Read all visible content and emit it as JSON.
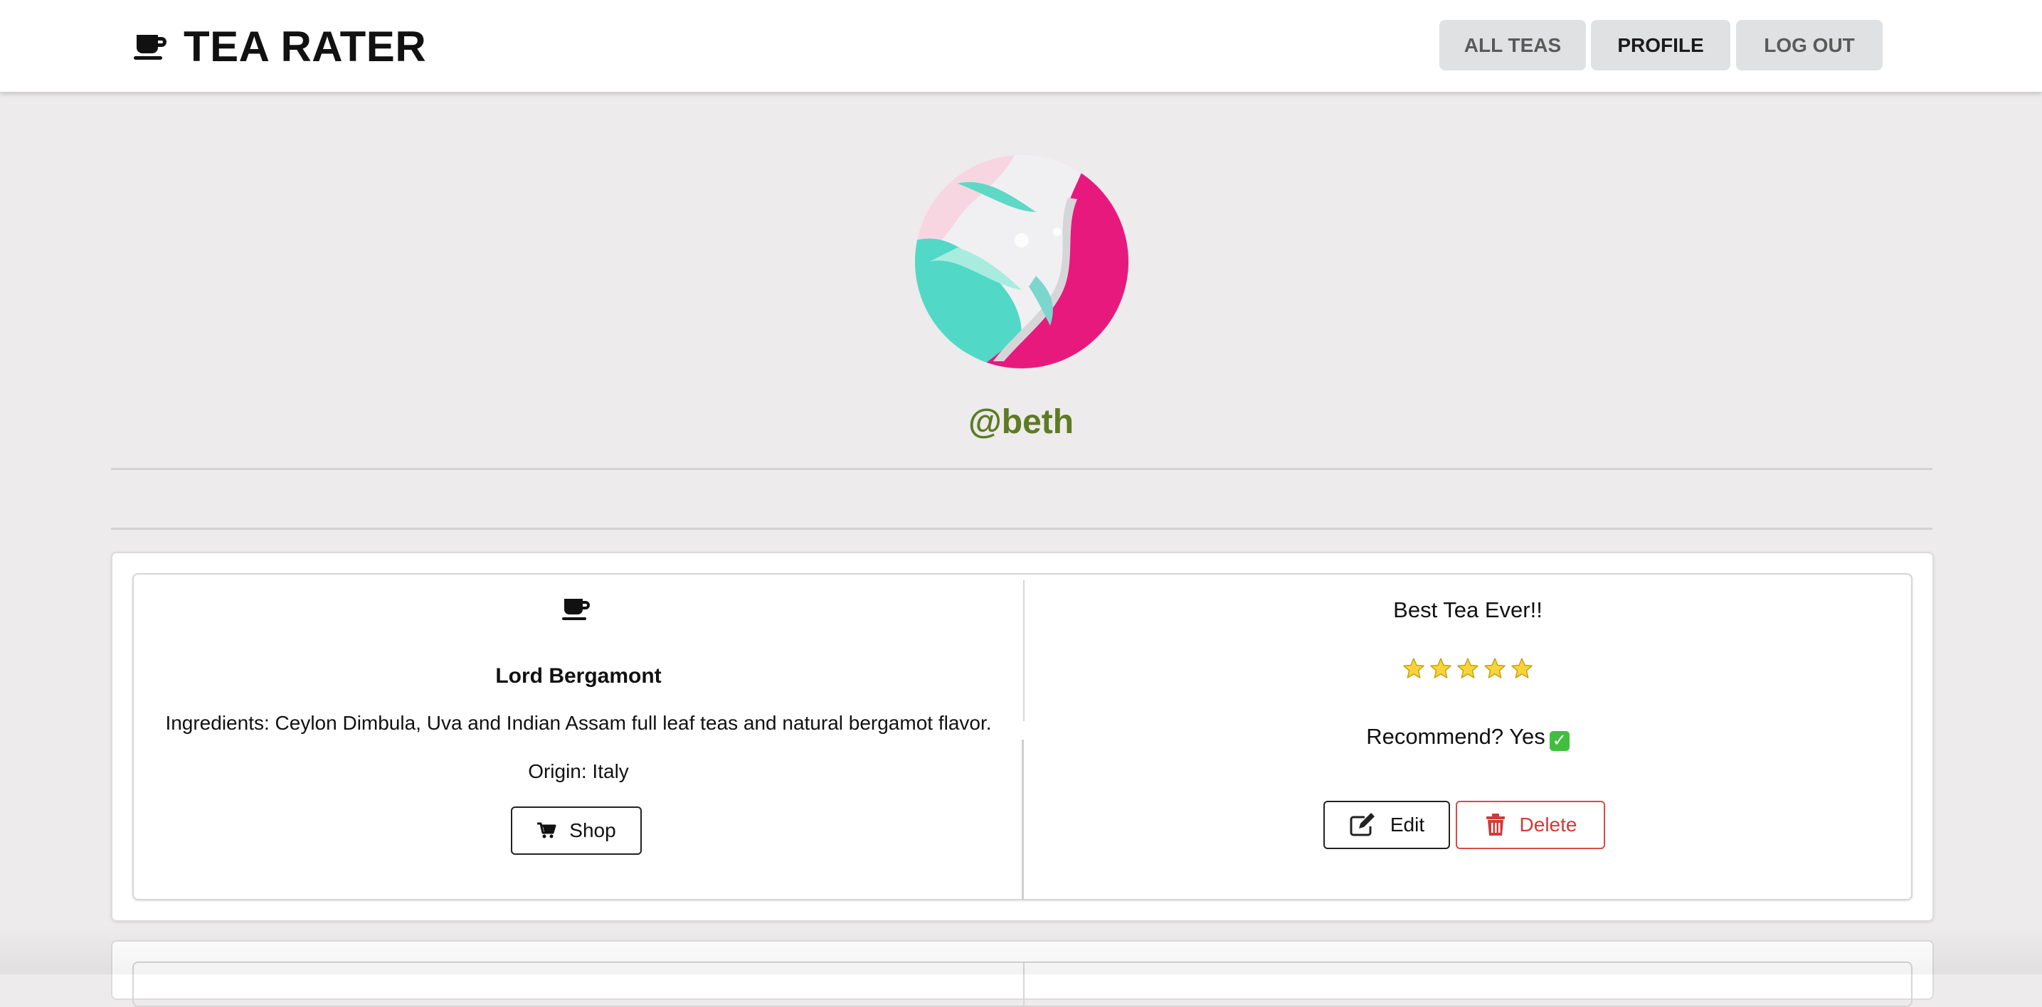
{
  "header": {
    "brand_icon": "coffee-cup-icon",
    "title": "TEA RATER",
    "nav": [
      {
        "label": "ALL TEAS",
        "active": false
      },
      {
        "label": "PROFILE",
        "active": true
      },
      {
        "label": "LOG OUT",
        "active": false
      }
    ]
  },
  "profile": {
    "username": "@beth",
    "avatar_colors": [
      "#e8197d",
      "#44d6c4",
      "#f4f4f4"
    ],
    "username_color": "#5e7a22"
  },
  "reviews": [
    {
      "tea": {
        "icon": "coffee-cup-icon",
        "name": "Lord Bergamont",
        "ingredients": "Ingredients: Ceylon Dimbula, Uva and Indian Assam full leaf teas and natural bergamot flavor.",
        "origin": "Origin: Italy",
        "shop_label": "Shop",
        "shop_icon": "cart-icon"
      },
      "review": {
        "title": "Best Tea Ever!!",
        "rating": 5,
        "rating_max": 5,
        "recommend_text": "Recommend? Yes",
        "recommend_icon": "check-mark-icon",
        "edit_label": "Edit",
        "edit_icon": "edit-icon",
        "delete_label": "Delete",
        "delete_icon": "trash-icon"
      }
    }
  ]
}
